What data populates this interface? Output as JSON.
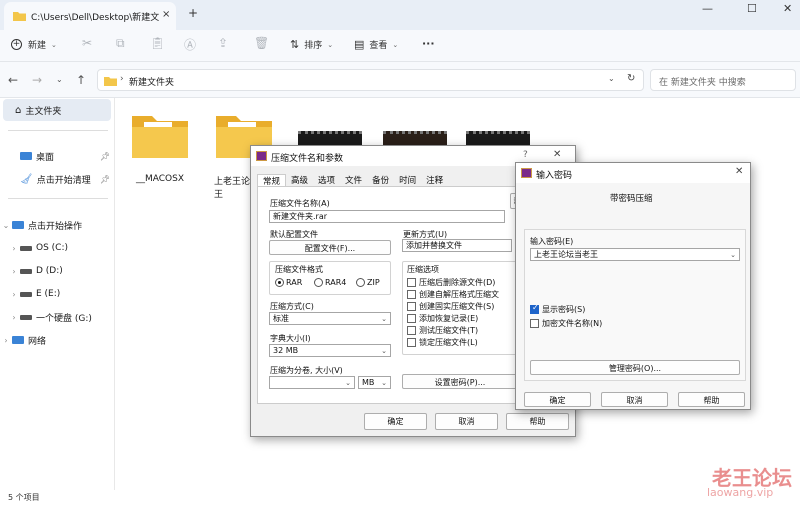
{
  "window": {
    "tab_title": "C:\\Users\\Dell\\Desktop\\新建文",
    "tab_close": "×",
    "new_tab": "+",
    "minimize": "—",
    "maximize": "☐",
    "close": "✕"
  },
  "toolbar": {
    "new_label": "新建",
    "sort_label": "排序",
    "view_label": "查看",
    "more": "···"
  },
  "address": {
    "separator": "›",
    "path": "新建文件夹",
    "search_placeholder": "在 新建文件夹 中搜索"
  },
  "sidebar": {
    "items": [
      {
        "label": "主文件夹"
      },
      {
        "label": "桌面"
      },
      {
        "label": "点击开始清理"
      },
      {
        "label": "点击开始操作"
      },
      {
        "label": "OS (C:)"
      },
      {
        "label": "D (D:)"
      },
      {
        "label": "E (E:)"
      },
      {
        "label": "一个硬盘 (G:)"
      },
      {
        "label": "网络"
      }
    ]
  },
  "files": [
    {
      "name": "__MACOSX",
      "kind": "folder"
    },
    {
      "name": "上老王论\n王",
      "kind": "folder"
    },
    {
      "name": "",
      "kind": "video"
    },
    {
      "name": "",
      "kind": "video"
    },
    {
      "name": "",
      "kind": "video"
    }
  ],
  "status": {
    "count": "5 个项目"
  },
  "archive_dialog": {
    "title": "压缩文件名和参数",
    "help_q": "?",
    "tabs": [
      "常规",
      "高级",
      "选项",
      "文件",
      "备份",
      "时间",
      "注释"
    ],
    "filename_label": "压缩文件名称(A)",
    "filename_value": "新建文件夹.rar",
    "browse_label": "浏",
    "profile_label": "默认配置文件",
    "profile_button": "配置文件(F)...",
    "update_label": "更新方式(U)",
    "update_value": "添加并替换文件",
    "format_group": "压缩文件格式",
    "formats": [
      "RAR",
      "RAR4",
      "ZIP"
    ],
    "method_label": "压缩方式(C)",
    "method_value": "标准",
    "dict_label": "字典大小(I)",
    "dict_value": "32 MB",
    "split_label": "压缩为分卷, 大小(V)",
    "split_unit": "MB",
    "options_group": "压缩选项",
    "options": [
      {
        "label": "压缩后删除源文件(D)",
        "checked": false
      },
      {
        "label": "创建自解压格式压缩文",
        "checked": false
      },
      {
        "label": "创建固实压缩文件(S)",
        "checked": false
      },
      {
        "label": "添加恢复记录(E)",
        "checked": false
      },
      {
        "label": "测试压缩文件(T)",
        "checked": false
      },
      {
        "label": "锁定压缩文件(L)",
        "checked": false
      }
    ],
    "set_password_button": "设置密码(P)...",
    "ok_button": "确定",
    "cancel_button": "取消",
    "help_button": "帮助"
  },
  "password_dialog": {
    "title": "输入密码",
    "subtitle": "带密码压缩",
    "password_label": "输入密码(E)",
    "password_value": "上老王论坛当老王",
    "show_password": {
      "label": "显示密码(S)",
      "checked": true
    },
    "encrypt_names": {
      "label": "加密文件名称(N)",
      "checked": false
    },
    "manage_button": "管理密码(O)...",
    "ok_button": "确定",
    "cancel_button": "取消",
    "help_button": "帮助"
  },
  "watermark": {
    "cn": "老王论坛",
    "en": "laowang.vip"
  },
  "colors": {
    "accent": "#1d63c9",
    "folder": "#f3c64a",
    "watermark": "#d73232"
  }
}
